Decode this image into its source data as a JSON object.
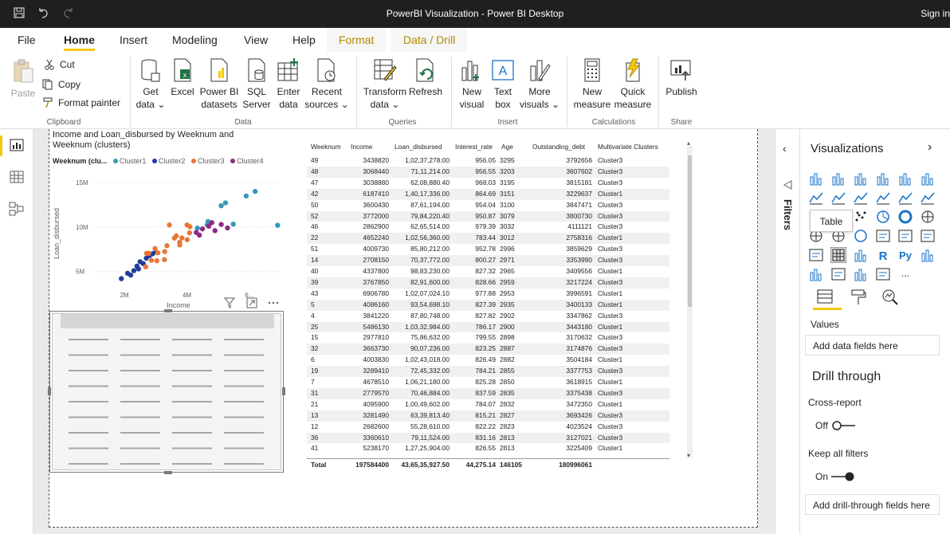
{
  "window": {
    "title": "PowerBI Visualization - Power BI Desktop",
    "sign_in": "Sign in"
  },
  "menu_tabs": [
    "File",
    "Home",
    "Insert",
    "Modeling",
    "View",
    "Help",
    "Format",
    "Data / Drill"
  ],
  "ribbon": {
    "clipboard": {
      "paste": "Paste",
      "cut": "Cut",
      "copy": "Copy",
      "format_painter": "Format painter",
      "group": "Clipboard"
    },
    "data": {
      "get_data": [
        "Get",
        "data"
      ],
      "excel": "Excel",
      "pbi_datasets": [
        "Power BI",
        "datasets"
      ],
      "sql": [
        "SQL",
        "Server"
      ],
      "enter_data": [
        "Enter",
        "data"
      ],
      "recent": [
        "Recent",
        "sources"
      ],
      "group": "Data"
    },
    "queries": {
      "transform": [
        "Transform",
        "data"
      ],
      "refresh": "Refresh",
      "group": "Queries"
    },
    "insert": {
      "new_visual": [
        "New",
        "visual"
      ],
      "text_box": [
        "Text",
        "box"
      ],
      "more_visuals": [
        "More",
        "visuals"
      ],
      "group": "Insert"
    },
    "calculations": {
      "new_measure": [
        "New",
        "measure"
      ],
      "quick_measure": [
        "Quick",
        "measure"
      ],
      "group": "Calculations"
    },
    "share": {
      "publish": "Publish",
      "group": "Share"
    }
  },
  "scatter": {
    "title": "Income and Loan_disbursed by Weeknum and Weeknum (clusters)",
    "legend_title": "Weeknum (clu...",
    "xlabel": "Income",
    "ylabel": "Loan_disbursed",
    "x_ticks": [
      "2M",
      "4M",
      "6..."
    ],
    "y_ticks": [
      "15M",
      "10M",
      "5M"
    ]
  },
  "chart_data": {
    "type": "scatter",
    "title": "Income and Loan_disbursed by Weeknum and Weeknum (clusters)",
    "xlabel": "Income",
    "ylabel": "Loan_disbursed",
    "xlim": [
      1000000,
      7000000
    ],
    "ylim": [
      3000000,
      16000000
    ],
    "series": [
      {
        "name": "Cluster1",
        "color": "#3599b8",
        "x": [
          6187410,
          6906780,
          5238170,
          5486130,
          4652240,
          4337800,
          4678510,
          5100000,
          5900000
        ],
        "y": [
          14013734,
          10207024,
          12725904,
          10332984,
          10256360,
          9883230,
          10621180,
          12400000,
          13500000
        ]
      },
      {
        "name": "Cluster2",
        "color": "#374649",
        "x": [
          1900000,
          2100000,
          2300000,
          2400000,
          2500000,
          2700000,
          2900000,
          2600000,
          2200000,
          2800000,
          3000000,
          2450000
        ],
        "y": [
          4200000,
          4800000,
          5100000,
          5600000,
          6100000,
          6500000,
          7000000,
          5900000,
          4600000,
          6800000,
          7200000,
          5300000
        ]
      },
      {
        "name": "Cluster3",
        "color": "#fd625e",
        "x": [
          3438820,
          3068440,
          3038880,
          3600430,
          3772000,
          2862900,
          4009730,
          2708150,
          3767850,
          4086160,
          3841220,
          2977810,
          3663730,
          4003830,
          3289410,
          2779570,
          4095900,
          3281490,
          2682600,
          3360610
        ],
        "y": [
          10237278,
          7111214,
          6208880,
          8761194,
          7984220,
          6265514,
          8580212,
          7037772,
          8291600,
          9354698,
          8780748,
          7586632,
          9007236,
          10243018,
          7245332,
          7046884,
          10049602,
          6339813,
          5528610,
          7911524
        ]
      },
      {
        "name": "Cluster4",
        "color": "#8e2b87",
        "x": [
          4300000,
          4500000,
          4700000,
          4900000,
          5100000,
          5300000,
          4400000,
          4800000
        ],
        "y": [
          9400000,
          9800000,
          10100000,
          9600000,
          10300000,
          9900000,
          9100000,
          10500000
        ]
      }
    ]
  },
  "table": {
    "headers": [
      "Weeknum",
      "Income",
      "Loan_disbursed",
      "Interest_rate",
      "Age",
      "Outstanding_debt",
      "Multivariate Clusters"
    ],
    "rows": [
      [
        "49",
        "3438820",
        "1,02,37,278.00",
        "956.05",
        "3295",
        "3792656",
        "Cluster3"
      ],
      [
        "48",
        "3068440",
        "71,11,214.00",
        "956.55",
        "3203",
        "3607602",
        "Cluster3"
      ],
      [
        "47",
        "3038880",
        "62,08,880.40",
        "968.03",
        "3195",
        "3815181",
        "Cluster3"
      ],
      [
        "42",
        "6187410",
        "1,40,17,336.00",
        "864.69",
        "3151",
        "3229637",
        "Cluster1"
      ],
      [
        "50",
        "3600430",
        "87,61,194.00",
        "954.04",
        "3100",
        "3847471",
        "Cluster3"
      ],
      [
        "52",
        "3772000",
        "79,84,220.40",
        "950.87",
        "3079",
        "3800730",
        "Cluster3"
      ],
      [
        "46",
        "2862900",
        "62,65,514.00",
        "979.39",
        "3032",
        "4111121",
        "Cluster3"
      ],
      [
        "22",
        "4652240",
        "1,02,56,360.00",
        "783.44",
        "3012",
        "2758316",
        "Cluster1"
      ],
      [
        "51",
        "4009730",
        "85,80,212.00",
        "952.78",
        "2996",
        "3859629",
        "Cluster3"
      ],
      [
        "14",
        "2708150",
        "70,37,772.00",
        "800.27",
        "2971",
        "3353990",
        "Cluster3"
      ],
      [
        "40",
        "4337800",
        "98,83,230.00",
        "827.32",
        "2965",
        "3409556",
        "Cluster1"
      ],
      [
        "39",
        "3767850",
        "82,91,600.00",
        "828.66",
        "2959",
        "3217224",
        "Cluster3"
      ],
      [
        "43",
        "6906780",
        "1,02,07,024.10",
        "977.88",
        "2953",
        "3996591",
        "Cluster1"
      ],
      [
        "5",
        "4086160",
        "93,54,698.10",
        "827.39",
        "2935",
        "3400133",
        "Cluster1"
      ],
      [
        "4",
        "3841220",
        "87,80,748.00",
        "827.82",
        "2902",
        "3347862",
        "Cluster3"
      ],
      [
        "25",
        "5486130",
        "1,03,32,984.00",
        "786.17",
        "2900",
        "3443180",
        "Cluster1"
      ],
      [
        "15",
        "2977810",
        "75,86,632.00",
        "799.55",
        "2898",
        "3170632",
        "Cluster3"
      ],
      [
        "32",
        "3663730",
        "90,07,236.00",
        "823.25",
        "2887",
        "3174876",
        "Cluster3"
      ],
      [
        "6",
        "4003830",
        "1,02,43,018.00",
        "826.49",
        "2882",
        "3504184",
        "Cluster1"
      ],
      [
        "19",
        "3289410",
        "72,45,332.00",
        "784.21",
        "2855",
        "3377753",
        "Cluster3"
      ],
      [
        "7",
        "4678510",
        "1,06,21,180.00",
        "825.28",
        "2850",
        "3618915",
        "Cluster1"
      ],
      [
        "31",
        "2779570",
        "70,46,884.00",
        "837.59",
        "2835",
        "3375438",
        "Cluster3"
      ],
      [
        "21",
        "4095900",
        "1,00,49,602.00",
        "784.07",
        "2832",
        "3472350",
        "Cluster1"
      ],
      [
        "13",
        "3281490",
        "63,39,813.40",
        "815.21",
        "2827",
        "3693426",
        "Cluster3"
      ],
      [
        "12",
        "2682600",
        "55,28,610.00",
        "822.22",
        "2823",
        "4023524",
        "Cluster3"
      ],
      [
        "36",
        "3360610",
        "79,11,524.00",
        "831.16",
        "2813",
        "3127021",
        "Cluster3"
      ],
      [
        "41",
        "5238170",
        "1,27,25,904.00",
        "826.55",
        "2813",
        "3225409",
        "Cluster1"
      ]
    ],
    "total": [
      "Total",
      "197584400",
      "43,65,35,927.50",
      "44,275.14",
      "146105",
      "",
      "180996061"
    ]
  },
  "filters_label": "Filters",
  "viz_pane": {
    "title": "Visualizations",
    "tooltip": "Table",
    "r_label": "R",
    "py_label": "Py",
    "more": "...",
    "values_label": "Values",
    "add_data_fields": "Add data fields here",
    "drill_through": "Drill through",
    "cross_report": "Cross-report",
    "off": "Off",
    "keep_all_filters": "Keep all filters",
    "on": "On",
    "add_drill_fields": "Add drill-through fields here"
  },
  "colors": {
    "accent": "#f2c811",
    "cluster1": "#3599b8",
    "cluster2": "#374649",
    "cluster3": "#fd625e",
    "cluster4": "#8e2b87"
  }
}
